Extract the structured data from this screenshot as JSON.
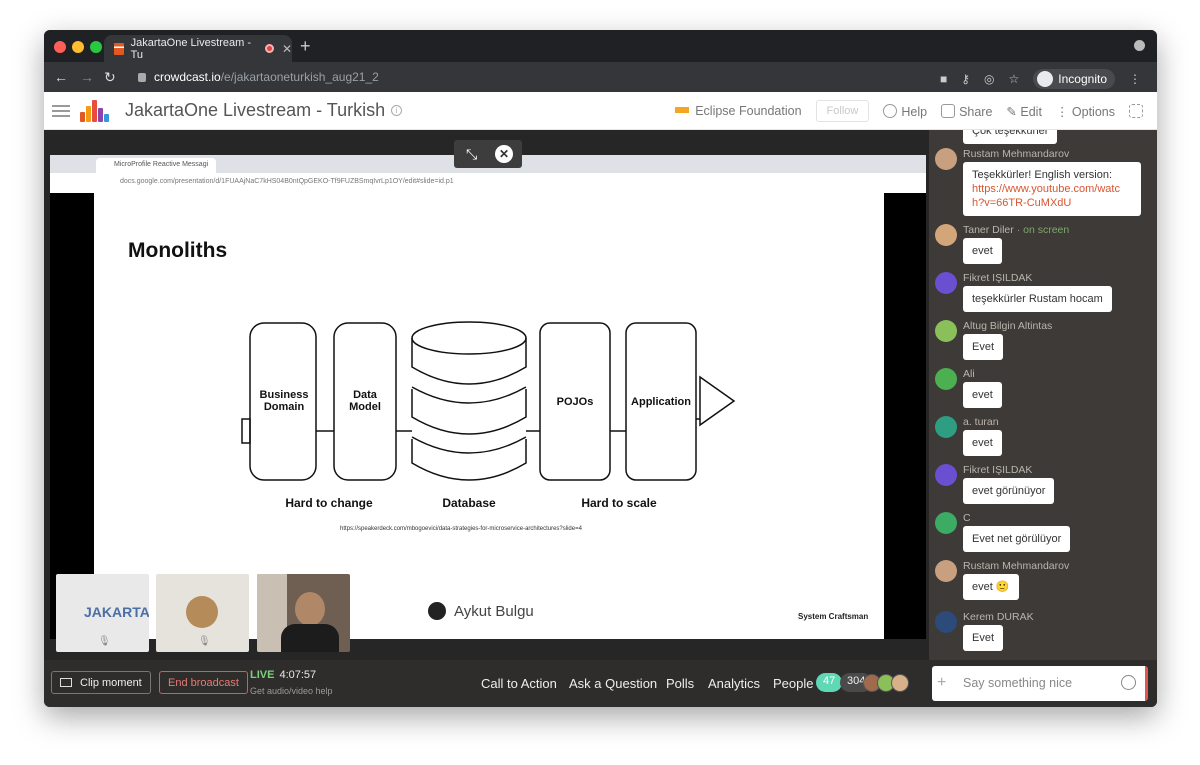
{
  "browser": {
    "tab_title": "JakartaOne Livestream - Tu",
    "url_host": "crowdcast.io",
    "url_path": "/e/jakartaoneturkish_aug21_2",
    "incognito_label": "Incognito"
  },
  "header": {
    "title": "JakartaOne Livestream - Turkish",
    "organizer": "Eclipse Foundation",
    "follow": "Follow",
    "help": "Help",
    "share": "Share",
    "edit": "Edit",
    "options": "Options"
  },
  "stage": {
    "inner_tab": "MicroProfile Reactive Messagi",
    "inner_url": "docs.google.com/presentation/d/1FUAAjNaC7kHS04B0ntQpGEKO-Tf9FUZBSmqIvrLp1OY/edit#slide=id.p1",
    "slide_title": "Monoliths",
    "box_business": "Business Domain",
    "box_data": "Data Model",
    "box_pojos": "POJOs",
    "box_app": "Application",
    "cap_change": "Hard to change",
    "cap_db": "Database",
    "cap_scale": "Hard to scale",
    "slide_url": "https://speakerdeck.com/mbogoevici/data-strategies-for-microservice-architectures?slide=4",
    "slide_brand": "System Craftsman",
    "speaker_name": "Aykut Bulgu",
    "thumb_logo": "JAKARTAOne"
  },
  "chat": {
    "messages": [
      {
        "name": "",
        "text": "Çok teşekkürler",
        "color": "#c0392b"
      },
      {
        "name": "Rustam Mehmandarov",
        "text": "Teşekkürler! English version:",
        "link": "https://www.youtube.com/watch?v=66TR-CuMXdU",
        "color": "#c8a080"
      },
      {
        "name": "Taner Diler",
        "onscreen": "· on screen",
        "text": "evet",
        "color": "#d2a679"
      },
      {
        "name": "Fikret IŞILDAK",
        "text": "teşekkürler Rustam hocam",
        "color": "#6a4fd0"
      },
      {
        "name": "Altug Bilgin Altintas",
        "text": "Evet",
        "color": "#8bbf5a"
      },
      {
        "name": "Ali",
        "text": "evet",
        "color": "#4caf50"
      },
      {
        "name": "a. turan",
        "text": "evet",
        "color": "#2e9e82"
      },
      {
        "name": "Fikret IŞILDAK",
        "text": "evet görünüyor",
        "color": "#6a4fd0"
      },
      {
        "name": "C",
        "text": "Evet net görülüyor",
        "color": "#3cab63"
      },
      {
        "name": "Rustam Mehmandarov",
        "text": "evet 🙂",
        "color": "#c8a080"
      },
      {
        "name": "Kerem DURAK",
        "text": "Evet",
        "color": "#2c4a7a"
      }
    ]
  },
  "bottom": {
    "clip": "Clip moment",
    "end": "End broadcast",
    "live": "LIVE",
    "time": "4:07:57",
    "help": "Get audio/video help",
    "cta": "Call to Action",
    "ask": "Ask a Question",
    "polls": "Polls",
    "analytics": "Analytics",
    "people": "People",
    "count_live": "47",
    "count_total": "304",
    "placeholder": "Say something nice"
  },
  "colors": {
    "accent": "#e0574f",
    "live_green": "#5fd8b5"
  }
}
